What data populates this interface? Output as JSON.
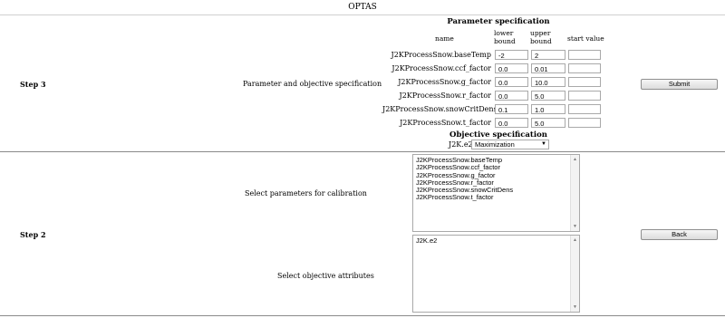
{
  "app": {
    "title": "OPTAS"
  },
  "step3": {
    "step_label": "Step 3",
    "description": "Parameter and objective specification",
    "param_section_title": "Parameter specification",
    "col_name": "name",
    "col_lower": "lower\nbound",
    "col_upper": "upper\nbound",
    "col_start": "start value",
    "params": [
      {
        "name": "J2KProcessSnow.baseTemp",
        "lower": "-2",
        "upper": "2",
        "start": ""
      },
      {
        "name": "J2KProcessSnow.ccf_factor",
        "lower": "0.0",
        "upper": "0.01",
        "start": ""
      },
      {
        "name": "J2KProcessSnow.g_factor",
        "lower": "0.0",
        "upper": "10.0",
        "start": ""
      },
      {
        "name": "J2KProcessSnow.r_factor",
        "lower": "0.0",
        "upper": "5.0",
        "start": ""
      },
      {
        "name": "J2KProcessSnow.snowCritDens",
        "lower": "0.1",
        "upper": "1.0",
        "start": ""
      },
      {
        "name": "J2KProcessSnow.t_factor",
        "lower": "0.0",
        "upper": "5.0",
        "start": ""
      }
    ],
    "objective_section_title": "Objective specification",
    "objective_name": "J2K.e2",
    "objective_mode": "Maximization",
    "submit_label": "Submit"
  },
  "step2": {
    "step_label": "Step 2",
    "select_params_label": "Select parameters for calibration",
    "param_list": [
      "J2KProcessSnow.baseTemp",
      "J2KProcessSnow.ccf_factor",
      "J2KProcessSnow.g_factor",
      "J2KProcessSnow.r_factor",
      "J2KProcessSnow.snowCritDens",
      "J2KProcessSnow.t_factor"
    ],
    "select_objective_label": "Select objective attributes",
    "objective_list": [
      "J2K.e2"
    ],
    "back_label": "Back"
  }
}
